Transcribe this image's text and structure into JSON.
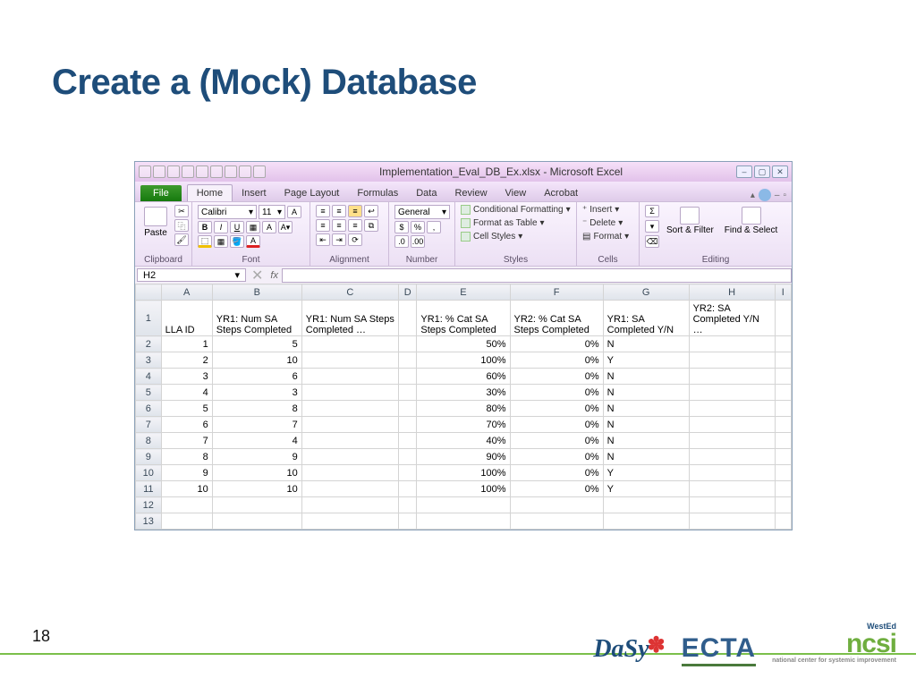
{
  "slide": {
    "title": "Create a (Mock) Database",
    "page_number": "18"
  },
  "titlebar": {
    "text": "Implementation_Eval_DB_Ex.xlsx - Microsoft Excel"
  },
  "ribbon": {
    "file": "File",
    "tabs": [
      "Home",
      "Insert",
      "Page Layout",
      "Formulas",
      "Data",
      "Review",
      "View",
      "Acrobat"
    ],
    "groups": {
      "clipboard": {
        "label": "Clipboard",
        "paste": "Paste"
      },
      "font": {
        "label": "Font",
        "font_name": "Calibri",
        "font_size": "11"
      },
      "alignment": {
        "label": "Alignment"
      },
      "number": {
        "label": "Number",
        "format": "General"
      },
      "styles": {
        "label": "Styles",
        "cond": "Conditional Formatting",
        "table": "Format as Table",
        "cell": "Cell Styles"
      },
      "cells": {
        "label": "Cells",
        "insert": "Insert",
        "delete": "Delete",
        "format": "Format"
      },
      "editing": {
        "label": "Editing",
        "sort": "Sort & Filter",
        "find": "Find & Select"
      }
    }
  },
  "namebox": {
    "cell": "H2",
    "fx": "fx"
  },
  "sheet": {
    "columns": [
      "A",
      "B",
      "C",
      "D",
      "E",
      "F",
      "G",
      "H",
      "I"
    ],
    "headers": {
      "A": "LLA ID",
      "B": "YR1: Num SA Steps Completed",
      "C": "YR1: Num SA Steps Completed  …",
      "E": "YR1: % Cat SA Steps Completed",
      "F": "YR2: % Cat SA Steps Completed",
      "G": "YR1: SA Completed Y/N",
      "H": "YR2: SA Completed Y/N  …"
    },
    "rows": [
      {
        "n": 2,
        "A": "1",
        "B": "5",
        "E": "50%",
        "F": "0%",
        "G": "N"
      },
      {
        "n": 3,
        "A": "2",
        "B": "10",
        "E": "100%",
        "F": "0%",
        "G": "Y"
      },
      {
        "n": 4,
        "A": "3",
        "B": "6",
        "E": "60%",
        "F": "0%",
        "G": "N"
      },
      {
        "n": 5,
        "A": "4",
        "B": "3",
        "E": "30%",
        "F": "0%",
        "G": "N"
      },
      {
        "n": 6,
        "A": "5",
        "B": "8",
        "E": "80%",
        "F": "0%",
        "G": "N"
      },
      {
        "n": 7,
        "A": "6",
        "B": "7",
        "E": "70%",
        "F": "0%",
        "G": "N"
      },
      {
        "n": 8,
        "A": "7",
        "B": "4",
        "E": "40%",
        "F": "0%",
        "G": "N"
      },
      {
        "n": 9,
        "A": "8",
        "B": "9",
        "E": "90%",
        "F": "0%",
        "G": "N"
      },
      {
        "n": 10,
        "A": "9",
        "B": "10",
        "E": "100%",
        "F": "0%",
        "G": "Y"
      },
      {
        "n": 11,
        "A": "10",
        "B": "10",
        "E": "100%",
        "F": "0%",
        "G": "Y"
      },
      {
        "n": 12
      },
      {
        "n": 13
      }
    ]
  },
  "logos": {
    "dasy": "DaSy",
    "ecta": "ECTA",
    "ncsi_top": "WestEd",
    "ncsi": "ncsi",
    "ncsi_sub": "national center for systemic improvement"
  }
}
